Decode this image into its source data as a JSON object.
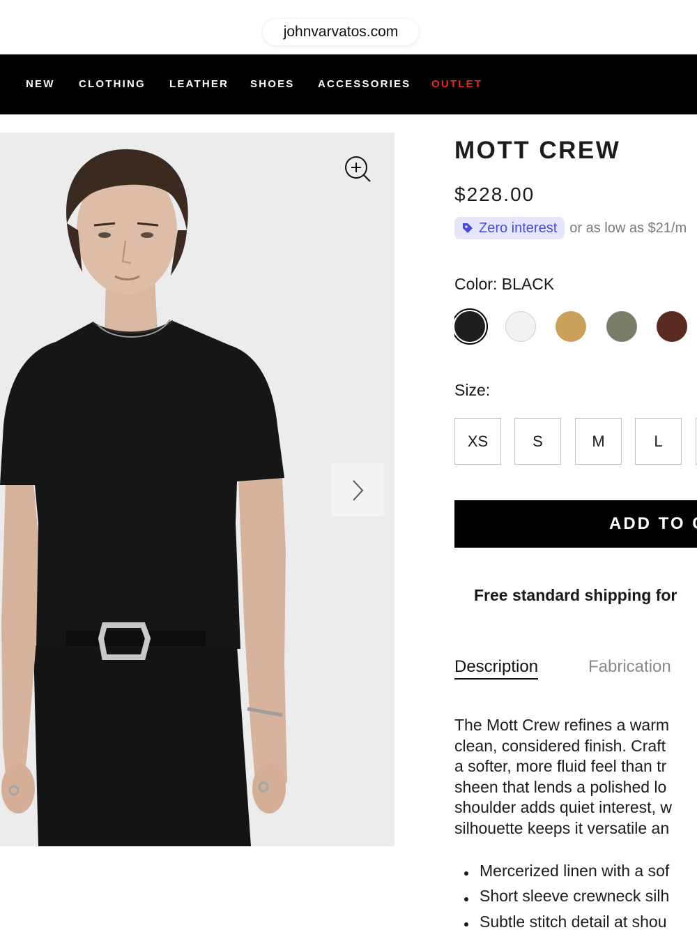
{
  "browser": {
    "url": "johnvarvatos.com"
  },
  "nav": {
    "items": [
      "NEW",
      "CLOTHING",
      "LEATHER",
      "SHOES",
      "ACCESSORIES",
      "OUTLET"
    ],
    "outlet_color": "#e4262b"
  },
  "gallery": {
    "zoom_icon": "zoom-in-icon",
    "next_icon": "chevron-right-icon"
  },
  "product": {
    "title": "MOTT CREW",
    "price": "$228.00",
    "financing": {
      "badge": "Zero interest",
      "note": "or as low as $21/m",
      "badge_color": "#4a4cd6"
    },
    "color_label": "Color: BLACK",
    "swatches": [
      {
        "name": "black",
        "color": "#1e1e1e",
        "selected": true
      },
      {
        "name": "white",
        "color": "#f2f2f0",
        "selected": false
      },
      {
        "name": "tan",
        "color": "#caa05a",
        "selected": false
      },
      {
        "name": "olive",
        "color": "#7a7d68",
        "selected": false
      },
      {
        "name": "brown",
        "color": "#5a2a22",
        "selected": false
      }
    ],
    "size_label": "Size:",
    "sizes": [
      "XS",
      "S",
      "M",
      "L"
    ],
    "add_to_cart": "ADD TO C",
    "shipping": "Free standard shipping for"
  },
  "tabs": {
    "description": "Description",
    "fabrication": "Fabrication"
  },
  "description": {
    "lines": [
      "The Mott Crew refines a warm",
      "clean, considered finish. Craft",
      "a softer, more fluid feel than tr",
      "sheen that lends a polished lo",
      "shoulder adds quiet interest, w",
      "silhouette keeps it versatile an"
    ],
    "bullets": [
      "Mercerized linen with a sof",
      "Short sleeve crewneck silh",
      "Subtle stitch detail at shou"
    ]
  }
}
